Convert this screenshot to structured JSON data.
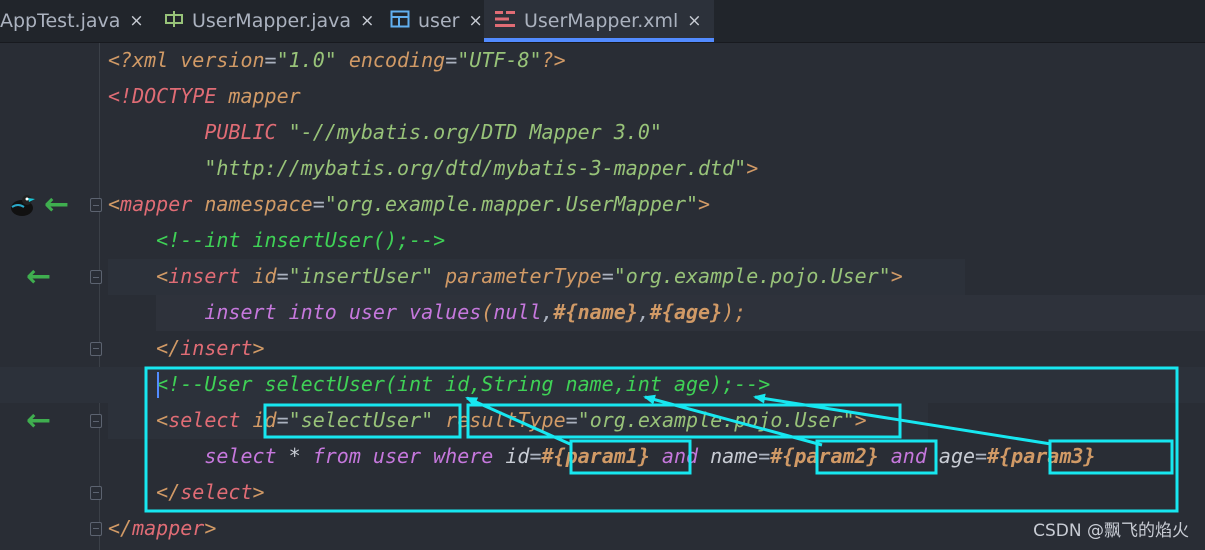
{
  "tabs": [
    {
      "label": "AppTest.java",
      "close": "×"
    },
    {
      "label": "UserMapper.java",
      "close": "×"
    },
    {
      "label": "user",
      "close": "×"
    },
    {
      "label": "UserMapper.xml",
      "close": "×"
    }
  ],
  "code": {
    "l1": {
      "a": "<?xml ",
      "b": "version",
      "c": "=",
      "d": "\"1.0\"",
      "e": " encoding",
      "f": "=",
      "g": "\"UTF-8\"",
      "h": "?>"
    },
    "l2": {
      "a": "<!DOCTYPE ",
      "b": "mapper"
    },
    "l3": {
      "a": "        PUBLIC ",
      "b": "\"-//mybatis.org/DTD Mapper 3.0\""
    },
    "l4": {
      "a": "        \"http://mybatis.org/dtd/mybatis-3-mapper.dtd\"",
      "b": ">"
    },
    "l5": {
      "a": "<",
      "b": "mapper",
      "c": " namespace",
      "d": "=",
      "e": "\"org.example.mapper.UserMapper\"",
      "f": ">"
    },
    "l6": {
      "a": "    <!--int insertUser();-->"
    },
    "l7": {
      "a": "    <",
      "b": "insert",
      "c": " id",
      "d": "=",
      "e": "\"insertUser\"",
      "f": " parameterType",
      "g": "=",
      "h": "\"org.example.pojo.User\"",
      "i": ">"
    },
    "l8": {
      "a": "        insert into user values",
      "b": "(",
      "c": "null",
      "d": ",",
      "e": "#{name}",
      "f": ",",
      "g": "#{age}",
      "h": ");"
    },
    "l9": {
      "a": "    </",
      "b": "insert",
      "c": ">"
    },
    "l10": {
      "a": "    <!--User selectUser(int id,String name,int age);-->"
    },
    "l11": {
      "a": "    <",
      "b": "select",
      "c": " ",
      "d": "id",
      "e": "=",
      "f": "\"selectUser\"",
      "g": " ",
      "h": "resultType",
      "i": "=",
      "j": "\"org.example.pojo.User\"",
      "k": ">"
    },
    "l12": {
      "a": "        select ",
      "b": "*",
      "c": " from user where ",
      "d": "id",
      "e": "=",
      "f": "#{param1}",
      "g": " and ",
      "h": "name",
      "i": "=",
      "j": "#{param2}",
      "k": " and ",
      "l": "age",
      "m": "=",
      "n": "#{param3}"
    },
    "l13": {
      "a": "    </",
      "b": "select",
      "c": ">"
    },
    "l14": {
      "a": "</",
      "b": "mapper",
      "c": ">"
    }
  },
  "watermark": "CSDN @飘飞的焰火",
  "colors": {
    "annotation": "#17e7f0",
    "gutter_arrow": "#3fae4f",
    "active_tab_underline": "#528bff"
  },
  "gutter_icons": [
    "mybatis-bird-icon",
    "navigate-arrow-icon"
  ]
}
